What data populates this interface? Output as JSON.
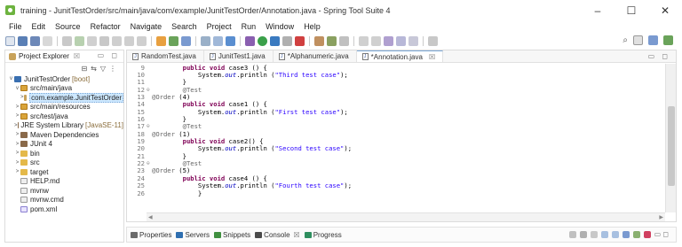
{
  "window": {
    "title": "training - JunitTestOrder/src/main/java/com/example/JunitTestOrder/Annotation.java - Spring Tool Suite 4",
    "controls": [
      "–",
      "☐",
      "✕"
    ]
  },
  "menu": [
    "File",
    "Edit",
    "Source",
    "Refactor",
    "Navigate",
    "Search",
    "Project",
    "Run",
    "Window",
    "Help"
  ],
  "project_explorer": {
    "tab_label": "Project Explorer",
    "tab_close": "☒",
    "tree": [
      {
        "label": "JunitTestOrder",
        "deco": "[boot]",
        "indent": 0,
        "arrow": "v",
        "icon": "project-icon"
      },
      {
        "label": "src/main/java",
        "indent": 1,
        "arrow": "v",
        "icon": "source-folder-icon"
      },
      {
        "label": "com.example.JunitTestOrder",
        "indent": 2,
        "arrow": ">",
        "icon": "package-icon",
        "selected": true
      },
      {
        "label": "src/main/resources",
        "indent": 1,
        "arrow": ">",
        "icon": "source-folder-icon"
      },
      {
        "label": "src/test/java",
        "indent": 1,
        "arrow": ">",
        "icon": "source-folder-icon"
      },
      {
        "label": "JRE System Library",
        "deco": "[JavaSE-11]",
        "indent": 1,
        "arrow": ">",
        "icon": "library-icon"
      },
      {
        "label": "Maven Dependencies",
        "indent": 1,
        "arrow": ">",
        "icon": "library-icon"
      },
      {
        "label": "JUnit 4",
        "indent": 1,
        "arrow": ">",
        "icon": "library-icon"
      },
      {
        "label": "bin",
        "indent": 1,
        "arrow": ">",
        "icon": "folder-icon"
      },
      {
        "label": "src",
        "indent": 1,
        "arrow": ">",
        "icon": "folder-icon"
      },
      {
        "label": "target",
        "indent": 1,
        "arrow": ">",
        "icon": "folder-icon"
      },
      {
        "label": "HELP.md",
        "indent": 1,
        "arrow": "",
        "icon": "file-icon"
      },
      {
        "label": "mvnw",
        "indent": 1,
        "arrow": "",
        "icon": "file-icon"
      },
      {
        "label": "mvnw.cmd",
        "indent": 1,
        "arrow": "",
        "icon": "file-icon"
      },
      {
        "label": "pom.xml",
        "indent": 1,
        "arrow": "",
        "icon": "xml-file-icon"
      }
    ]
  },
  "editor": {
    "tabs": [
      {
        "label": "RandomTest.java",
        "active": false
      },
      {
        "label": "JunitTest1.java",
        "active": false
      },
      {
        "label": "*Alphanumeric.java",
        "active": false
      },
      {
        "label": "*Annotation.java",
        "active": true,
        "close": "☒"
      }
    ],
    "lines": [
      {
        "n": "9",
        "fold": "",
        "parts": [
          [
            "",
            "        "
          ],
          [
            "kw",
            "public"
          ],
          [
            "",
            " "
          ],
          [
            "kw",
            "void"
          ],
          [
            "",
            " case3 () {"
          ]
        ]
      },
      {
        "n": "10",
        "fold": "",
        "parts": [
          [
            "",
            "            System."
          ],
          [
            "field",
            "out"
          ],
          [
            "",
            ".println ("
          ],
          [
            "str",
            "\"Third test case\""
          ],
          [
            "",
            ");"
          ]
        ]
      },
      {
        "n": "11",
        "fold": "",
        "parts": [
          [
            "",
            "        }"
          ]
        ]
      },
      {
        "n": "12",
        "fold": "⊖",
        "parts": [
          [
            "ann",
            "        @Test"
          ]
        ]
      },
      {
        "n": "13",
        "fold": "",
        "parts": [
          [
            "ann",
            "@Order"
          ],
          [
            "",
            " (4)"
          ]
        ]
      },
      {
        "n": "14",
        "fold": "",
        "parts": [
          [
            "",
            "        "
          ],
          [
            "kw",
            "public"
          ],
          [
            "",
            " "
          ],
          [
            "kw",
            "void"
          ],
          [
            "",
            " case1 () {"
          ]
        ]
      },
      {
        "n": "15",
        "fold": "",
        "parts": [
          [
            "",
            "            System."
          ],
          [
            "field",
            "out"
          ],
          [
            "",
            ".println ("
          ],
          [
            "str",
            "\"First test case\""
          ],
          [
            "",
            ");"
          ]
        ]
      },
      {
        "n": "16",
        "fold": "",
        "parts": [
          [
            "",
            "        }"
          ]
        ]
      },
      {
        "n": "17",
        "fold": "⊖",
        "parts": [
          [
            "ann",
            "        @Test"
          ]
        ]
      },
      {
        "n": "18",
        "fold": "",
        "parts": [
          [
            "ann",
            "@Order"
          ],
          [
            "",
            " (1)"
          ]
        ]
      },
      {
        "n": "19",
        "fold": "",
        "parts": [
          [
            "",
            "        "
          ],
          [
            "kw",
            "public"
          ],
          [
            "",
            " "
          ],
          [
            "kw",
            "void"
          ],
          [
            "",
            " case2() {"
          ]
        ]
      },
      {
        "n": "20",
        "fold": "",
        "parts": [
          [
            "",
            "            System."
          ],
          [
            "field",
            "out"
          ],
          [
            "",
            ".println ("
          ],
          [
            "str",
            "\"Second test case\""
          ],
          [
            "",
            ");"
          ]
        ]
      },
      {
        "n": "21",
        "fold": "",
        "parts": [
          [
            "",
            "        }"
          ]
        ]
      },
      {
        "n": "22",
        "fold": "⊖",
        "parts": [
          [
            "ann",
            "        @Test"
          ]
        ]
      },
      {
        "n": "23",
        "fold": "",
        "parts": [
          [
            "ann",
            "@Order"
          ],
          [
            "",
            " (5)"
          ]
        ]
      },
      {
        "n": "24",
        "fold": "",
        "parts": [
          [
            "",
            "        "
          ],
          [
            "kw",
            "public"
          ],
          [
            "",
            " "
          ],
          [
            "kw",
            "void"
          ],
          [
            "",
            " case4 () {"
          ]
        ]
      },
      {
        "n": "25",
        "fold": "",
        "parts": [
          [
            "",
            "            System."
          ],
          [
            "field",
            "out"
          ],
          [
            "",
            ".println ("
          ],
          [
            "str",
            "\"Fourth test case\""
          ],
          [
            "",
            ");"
          ]
        ]
      },
      {
        "n": "26",
        "fold": "",
        "parts": [
          [
            "",
            "            }"
          ]
        ]
      }
    ]
  },
  "bottom_panel": {
    "tabs": [
      {
        "label": "Properties",
        "icon": "properties-icon",
        "color": "#6a6a6a"
      },
      {
        "label": "Servers",
        "icon": "servers-icon",
        "color": "#2f6fb0"
      },
      {
        "label": "Snippets",
        "icon": "snippets-icon",
        "color": "#3f8f3f"
      },
      {
        "label": "Console",
        "icon": "console-icon",
        "color": "#4a4a4a",
        "close": "☒"
      },
      {
        "label": "Progress",
        "icon": "progress-icon",
        "color": "#2f8f5f"
      }
    ]
  },
  "colors": {
    "keyword": "#7f0055",
    "string": "#2a00ff",
    "annotation": "#646464",
    "field": "#0000c0"
  }
}
